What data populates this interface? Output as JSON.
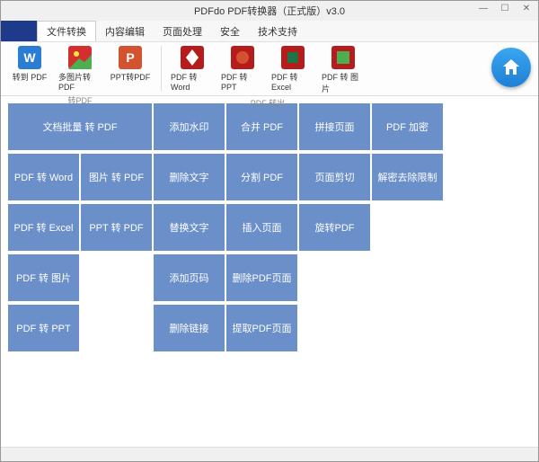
{
  "title": "PDFdo  PDF转换器（正式版）v3.0",
  "menu": [
    "文件转换",
    "内容编辑",
    "页面处理",
    "安全",
    "技术支持"
  ],
  "toolbar": {
    "group1_label": "转PDF",
    "group2_label": "PDF 转出",
    "items1": [
      "转到 PDF",
      "多图片转PDF",
      "PPT转PDF"
    ],
    "items2": [
      "PDF 转 Word",
      "PDF 转 PPT",
      "PDF 转 Excel",
      "PDF 转 图片"
    ]
  },
  "tiles": {
    "r0": [
      "文档批量 转 PDF",
      "添加水印",
      "合并 PDF",
      "拼接页面",
      "PDF 加密"
    ],
    "r1": [
      "PDF 转 Word",
      "图片 转 PDF",
      "删除文字",
      "分割 PDF",
      "页面剪切",
      "解密去除限制"
    ],
    "r2": [
      "PDF 转 Excel",
      "PPT 转 PDF",
      "替换文字",
      "插入页面",
      "旋转PDF"
    ],
    "r3": [
      "PDF 转 图片",
      "添加页码",
      "删除PDF页面"
    ],
    "r4": [
      "PDF 转 PPT",
      "删除链接",
      "提取PDF页面"
    ]
  }
}
